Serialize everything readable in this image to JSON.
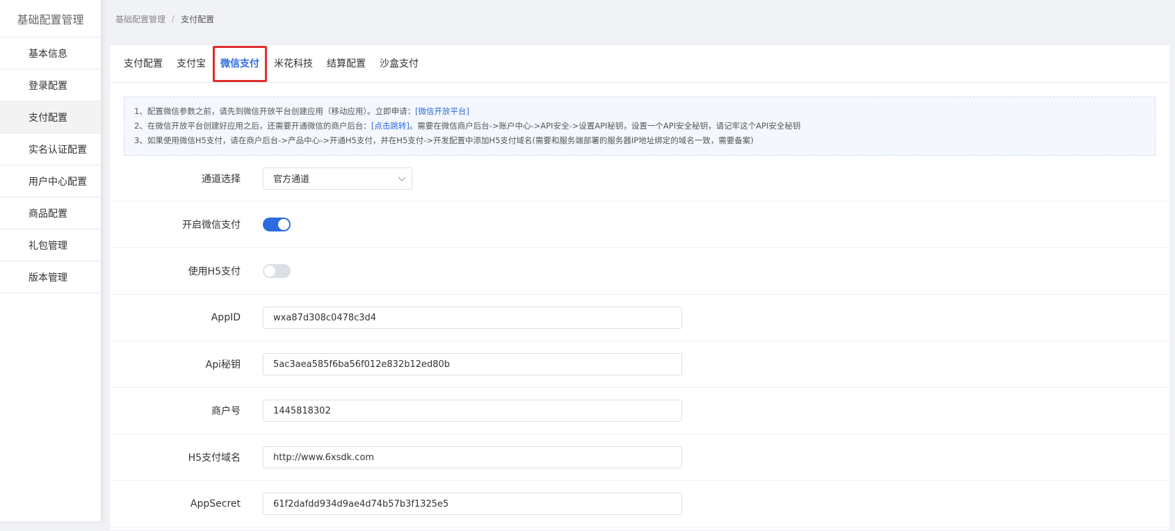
{
  "sidebar": {
    "title": "基础配置管理",
    "items": [
      {
        "label": "基本信息"
      },
      {
        "label": "登录配置"
      },
      {
        "label": "支付配置"
      },
      {
        "label": "实名认证配置"
      },
      {
        "label": "用户中心配置"
      },
      {
        "label": "商品配置"
      },
      {
        "label": "礼包管理"
      },
      {
        "label": "版本管理"
      }
    ],
    "active_index": 2
  },
  "breadcrumb": {
    "root": "基础配置管理",
    "separator": "/",
    "current": "支付配置"
  },
  "tabs": [
    {
      "label": "支付配置"
    },
    {
      "label": "支付宝"
    },
    {
      "label": "微信支付"
    },
    {
      "label": "米花科技"
    },
    {
      "label": "结算配置"
    },
    {
      "label": "沙盒支付"
    }
  ],
  "active_tab": 2,
  "notice": {
    "line1_prefix": "1、配置微信参数之前，请先到微信开放平台创建应用（移动应用）。立即申请：",
    "line1_link": "[微信开放平台]",
    "line2_prefix": "2、在微信开放平台创建好应用之后，还需要开通微信的商户后台：",
    "line2_link": "[点击跳转]",
    "line2_suffix": "。需要在微信商户后台->账户中心->API安全->设置API秘钥，设置一个API安全秘钥，请记牢这个API安全秘钥",
    "line3": "3、如果使用微信H5支付，请在商户后台->产品中心->开通H5支付，并在H5支付->开发配置中添加H5支付域名(需要和服务端部署的服务器IP地址绑定的域名一致，需要备案)"
  },
  "form": {
    "channel": {
      "label": "通道选择",
      "value": "官方通道"
    },
    "enable_wechat": {
      "label": "开启微信支付",
      "on": true
    },
    "use_h5": {
      "label": "使用H5支付",
      "on": false
    },
    "appid": {
      "label": "AppID",
      "value": "wxa87d308c0478c3d4"
    },
    "api_secret": {
      "label": "Api秘钥",
      "value": "5ac3aea585f6ba56f012e832b12ed80b"
    },
    "merchant_id": {
      "label": "商户号",
      "value": "1445818302"
    },
    "h5_domain": {
      "label": "H5支付域名",
      "value": "http://www.6xsdk.com"
    },
    "app_secret": {
      "label": "AppSecret",
      "value": "61f2dafdd934d9ae4d74b57b3f1325e5"
    }
  },
  "colors": {
    "accent": "#2d6cdf",
    "highlight_border": "#e02d2d"
  }
}
